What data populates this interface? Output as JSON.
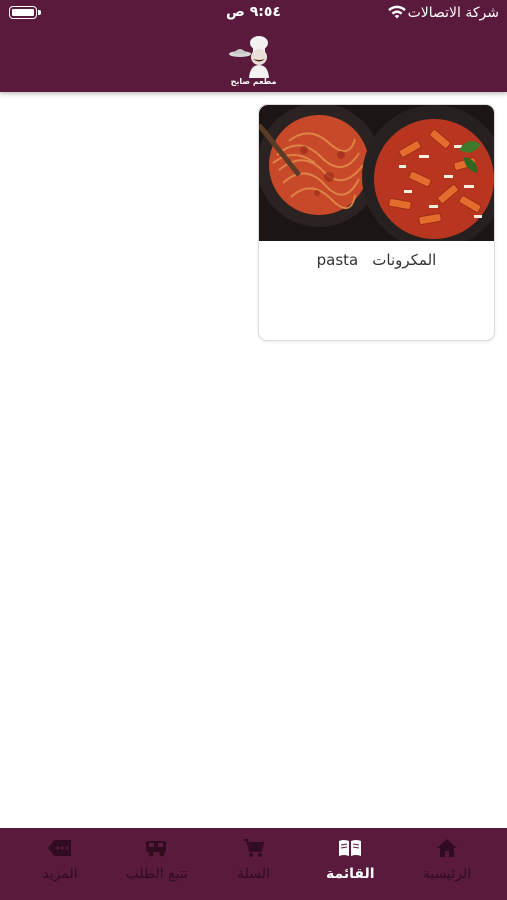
{
  "status_bar": {
    "carrier": "شركة الاتصالات",
    "time": "٩:٥٤ ص"
  },
  "header": {
    "logo_text": "مطعم صابح",
    "logo_icon": "chef-logo-icon"
  },
  "colors": {
    "brand": "#5a1a3c",
    "inactive_nav": "#2a0a1c",
    "active_nav": "#ffffff"
  },
  "categories": [
    {
      "name_ar": "المكرونات",
      "name_en": "pasta",
      "image": "pasta-dishes-image"
    }
  ],
  "bottom_nav": {
    "items": [
      {
        "label": "الرئيسية",
        "icon": "home-icon",
        "active": false
      },
      {
        "label": "القائمة",
        "icon": "menu-book-icon",
        "active": true
      },
      {
        "label": "السلة",
        "icon": "cart-icon",
        "active": false
      },
      {
        "label": "تتبع الطلب",
        "icon": "delivery-truck-icon",
        "active": false
      },
      {
        "label": "المزيد",
        "icon": "more-tag-icon",
        "active": false
      }
    ]
  }
}
